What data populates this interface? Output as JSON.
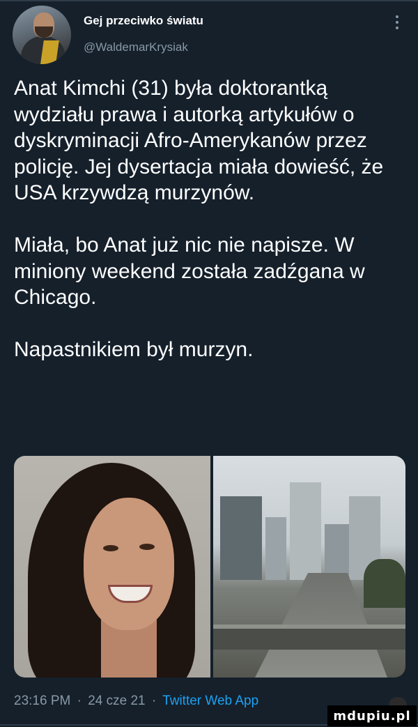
{
  "tweet": {
    "author": {
      "display_name": "Gej przeciwko światu",
      "handle": "@WaldemarKrysiak"
    },
    "paragraphs": [
      "Anat Kimchi (31) była doktorantką wydziału prawa i autorką artykułów o dyskryminacji Afro-Amerykanów przez policję. Jej dysertacja miała dowieść, że USA krzywdzą murzynów.",
      "Miała, bo Anat już nic nie napisze. W miniony weekend została zadźgana w Chicago.",
      "Napastnikiem był murzyn."
    ],
    "meta": {
      "time": "23:16 PM",
      "date": "24 cze 21",
      "separator": "·",
      "source": "Twitter Web App"
    }
  },
  "watermark": {
    "text": "mdupiu.pl"
  },
  "icons": {
    "more": "more-vertical-icon"
  },
  "colors": {
    "background": "#15202b",
    "text": "#ffffff",
    "secondary_text": "#8899a6",
    "link": "#1da1f2"
  }
}
